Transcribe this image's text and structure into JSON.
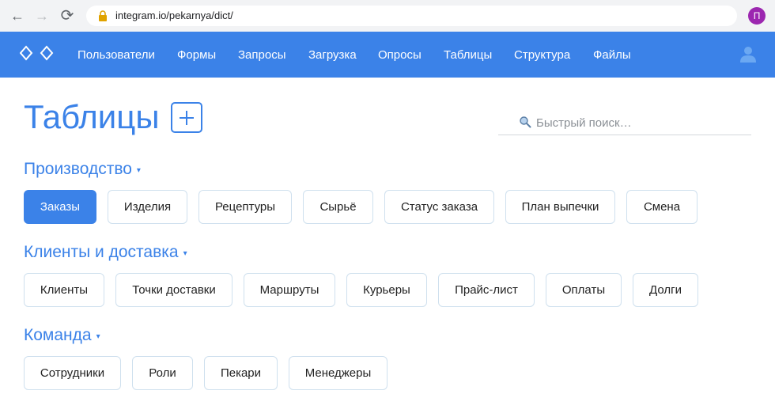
{
  "browser": {
    "back_label": "←",
    "forward_label": "→",
    "reload_label": "⟳",
    "url": "integram.io/pekarnya/dict/",
    "profile_initial": "П"
  },
  "nav": {
    "items": [
      "Пользователи",
      "Формы",
      "Запросы",
      "Загрузка",
      "Опросы",
      "Таблицы",
      "Структура",
      "Файлы"
    ]
  },
  "page": {
    "title": "Таблицы",
    "search_placeholder": "Быстрый поиск…"
  },
  "sections": [
    {
      "title": "Производство",
      "tables": [
        "Заказы",
        "Изделия",
        "Рецептуры",
        "Сырьё",
        "Статус заказа",
        "План выпечки",
        "Смена"
      ],
      "active": "Заказы"
    },
    {
      "title": "Клиенты и доставка",
      "tables": [
        "Клиенты",
        "Точки доставки",
        "Маршруты",
        "Курьеры",
        "Прайс-лист",
        "Оплаты",
        "Долги"
      ]
    },
    {
      "title": "Команда",
      "tables": [
        "Сотрудники",
        "Роли",
        "Пекари",
        "Менеджеры"
      ]
    }
  ],
  "caret_symbol": "▾",
  "colors": {
    "accent": "#3b82e8",
    "chip_border": "#cfe0ee",
    "avatar": "#9c27b0"
  }
}
